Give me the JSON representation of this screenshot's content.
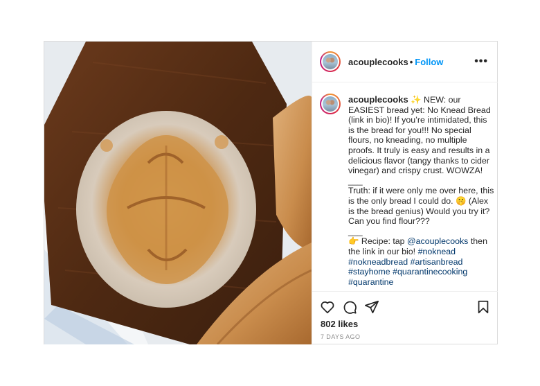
{
  "post": {
    "username": "acouplecooks",
    "header_separator": "•",
    "follow_label": "Follow",
    "more_icon": "more-options-icon",
    "caption": {
      "username": "acouplecooks",
      "sparkle": "✨",
      "text_1": "NEW: our EASIEST bread yet: No Knead Bread (link in bio)! If you’re intimidated, this is the bread for you!!! No special flours, no kneading, no multiple proofs. It truly is easy and results in a delicious flavor (tangy thanks to cider vinegar) and crispy crust. WOWZA!",
      "rule_1": "___",
      "text_2a": "Truth: if it were only me over here, this is the only bread I could do.",
      "emoji_2": "🤫",
      "text_2b": "(Alex is the bread genius) Would you try it? Can you find flour???",
      "rule_2": "___",
      "pointer": "👉",
      "text_3a": "Recipe: tap",
      "mention": "@acouplecooks",
      "text_3b": "then the link in our bio!",
      "hashtags": [
        "#noknead",
        "#nokneadbread",
        "#artisanbread",
        "#stayhome",
        "#quarantinecooking",
        "#quarantine"
      ]
    },
    "actions": {
      "like_icon": "heart-icon",
      "comment_icon": "comment-icon",
      "share_icon": "share-icon",
      "save_icon": "bookmark-icon"
    },
    "likes": "802 likes",
    "time_ago": "7 DAYS AGO"
  }
}
